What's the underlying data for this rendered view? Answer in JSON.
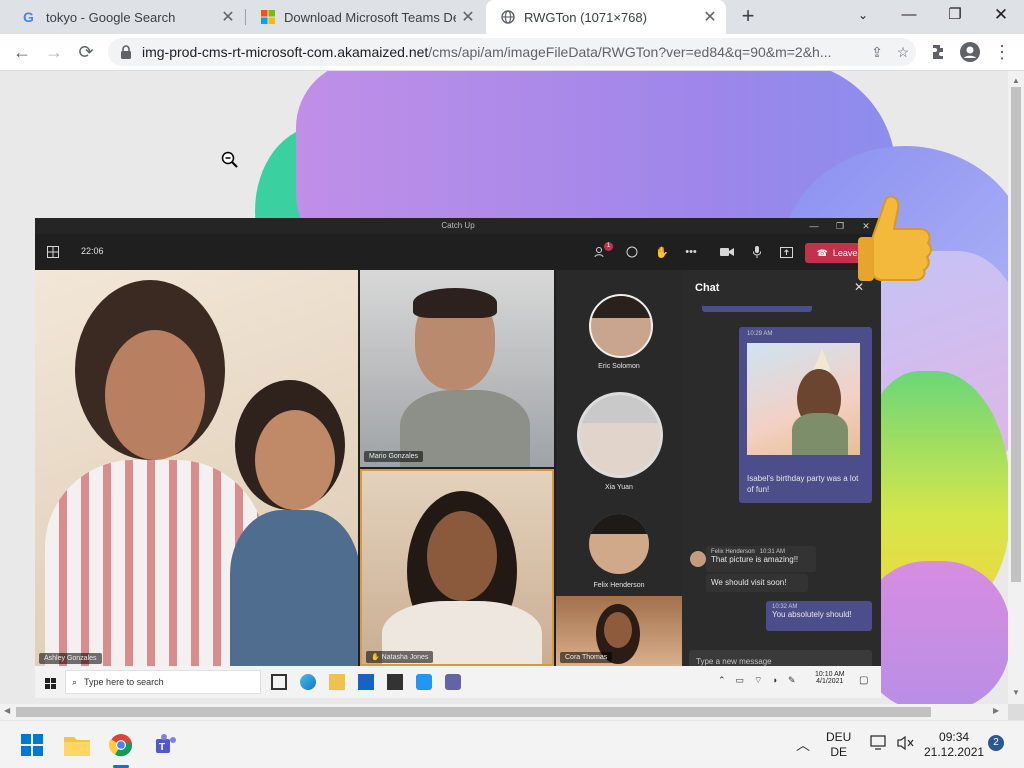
{
  "browser": {
    "tabs": [
      {
        "title": "tokyo - Google Search",
        "favicon": "google-icon"
      },
      {
        "title": "Download Microsoft Teams Desk",
        "favicon": "microsoft-icon"
      },
      {
        "title": "RWGTon (1071×768)",
        "favicon": "globe-icon"
      }
    ],
    "url_host": "img-prod-cms-rt-microsoft-com.akamaized.net",
    "url_rest": "/cms/api/am/imageFileData/RWGTon?ver=ed84&q=90&m=2&h..."
  },
  "teams": {
    "window_title": "Catch Up",
    "time": "22:06",
    "leave_label": "Leave",
    "participants_badge": "1",
    "tiles": {
      "ashley": "Ashley Gonzales",
      "mario": "Mario Gonzales",
      "natasha": "Natasha Jones",
      "cora": "Cora Thomas"
    },
    "strip": [
      "Eric Solomon",
      "Xia Yuan",
      "Felix Henderson"
    ],
    "chat": {
      "header": "Chat",
      "img_time": "10:29 AM",
      "caption": "Isabel's birthday party was a lot of fun!",
      "felix_name": "Felix Henderson",
      "felix_time": "10:31 AM",
      "felix_msg1": "That picture is amazing!!",
      "felix_msg2": "We should visit soon!",
      "reply_time": "10:32 AM",
      "reply_msg": "You absolutely should!",
      "compose_placeholder": "Type a new message"
    },
    "inner_taskbar": {
      "search_placeholder": "Type here to search",
      "clock_time": "10:10 AM",
      "clock_date": "4/1/2021"
    }
  },
  "taskbar": {
    "lang_line1": "DEU",
    "lang_line2": "DE",
    "time": "09:34",
    "date": "21.12.2021",
    "notification_count": "2"
  },
  "colors": {
    "leave": "#c4314b",
    "chat_bubble_self": "#4b4e8a",
    "accent_teams": "#6264a7"
  }
}
